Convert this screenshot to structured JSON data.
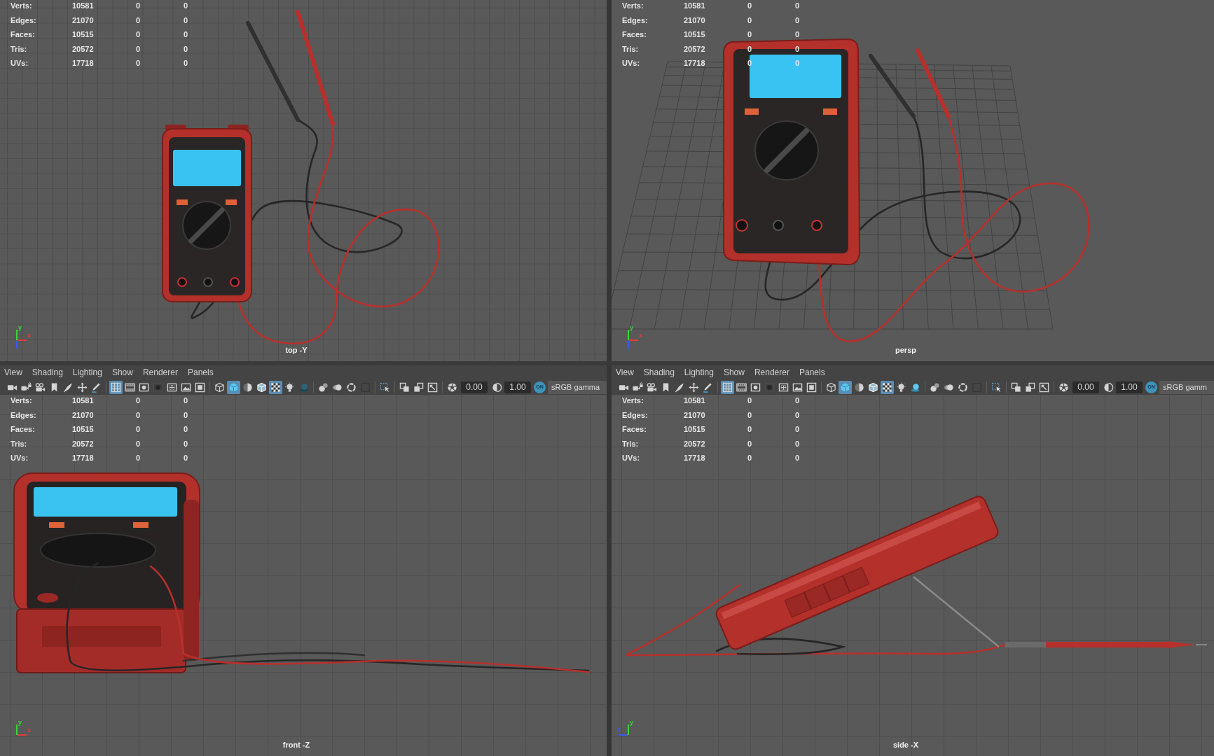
{
  "viewports": [
    {
      "kind": "top",
      "hud": [
        {
          "label": "Verts:",
          "values": [
            "10581",
            "0",
            "0"
          ]
        },
        {
          "label": "Edges:",
          "values": [
            "21070",
            "0",
            "0"
          ]
        },
        {
          "label": "Faces:",
          "values": [
            "10515",
            "0",
            "0"
          ]
        },
        {
          "label": "Tris:",
          "values": [
            "20572",
            "0",
            "0"
          ]
        },
        {
          "label": "UVs:",
          "values": [
            "17718",
            "0",
            "0"
          ]
        }
      ],
      "axes": [
        {
          "label": "y",
          "color": "#3cd43c"
        },
        {
          "label": "x",
          "color": "#e23b3b"
        },
        {
          "color": "#3b5bea"
        }
      ],
      "camera": "top -Y"
    },
    {
      "kind": "persp",
      "hud": [
        {
          "label": "Verts:",
          "values": [
            "10581",
            "0",
            "0"
          ]
        },
        {
          "label": "Edges:",
          "values": [
            "21070",
            "0",
            "0"
          ]
        },
        {
          "label": "Faces:",
          "values": [
            "10515",
            "0",
            "0"
          ]
        },
        {
          "label": "Tris:",
          "values": [
            "20572",
            "0",
            "0"
          ]
        },
        {
          "label": "UVs:",
          "values": [
            "17718",
            "0",
            "0"
          ]
        }
      ],
      "axes": [
        {
          "label": "y",
          "color": "#3cd43c"
        },
        {
          "label": "x",
          "color": "#e23b3b"
        },
        {
          "color": "#3b5bea"
        }
      ],
      "camera": "persp"
    },
    {
      "kind": "front",
      "menu": [
        "View",
        "Shading",
        "Lighting",
        "Show",
        "Renderer",
        "Panels"
      ],
      "toolbar": {
        "groups": [
          {
            "buttons": [
              {
                "on": false,
                "disabled": false
              },
              {
                "on": false,
                "disabled": false
              },
              {
                "on": false,
                "disabled": false
              },
              {
                "on": false,
                "disabled": false
              },
              {
                "on": false,
                "disabled": false
              },
              {
                "on": false,
                "disabled": false
              },
              {
                "on": false,
                "disabled": false
              }
            ]
          },
          {
            "buttons": [
              {
                "on": true,
                "disabled": false
              },
              {
                "on": false,
                "disabled": false
              },
              {
                "on": false,
                "disabled": false
              },
              {
                "on": false,
                "disabled": true
              },
              {
                "on": false,
                "disabled": false
              },
              {
                "on": false,
                "disabled": false
              },
              {
                "on": false,
                "disabled": false
              }
            ]
          },
          {
            "buttons": [
              {
                "on": false,
                "disabled": false
              },
              {
                "on": true,
                "disabled": false
              },
              {
                "on": false,
                "disabled": false
              },
              {
                "on": false,
                "disabled": false
              },
              {
                "on": true,
                "disabled": false
              },
              {
                "on": false,
                "disabled": false
              },
              {
                "on": false,
                "disabled": true
              }
            ]
          },
          {
            "buttons": [
              {
                "on": false,
                "disabled": false
              },
              {
                "on": false,
                "disabled": false
              },
              {
                "on": false,
                "disabled": false
              },
              {
                "on": false,
                "disabled": true
              }
            ]
          },
          {
            "buttons": [
              {
                "on": false,
                "disabled": false
              }
            ]
          },
          {
            "buttons": [
              {
                "on": false,
                "disabled": false
              },
              {
                "on": false,
                "disabled": false
              },
              {
                "on": false,
                "disabled": false
              }
            ]
          }
        ],
        "exposure": "0.00",
        "gamma": "1.00",
        "color_management": {
          "toggle": "ON",
          "label": "sRGB gamma"
        }
      },
      "hud": [
        {
          "label": "Verts:",
          "values": [
            "10581",
            "0",
            "0"
          ]
        },
        {
          "label": "Edges:",
          "values": [
            "21070",
            "0",
            "0"
          ]
        },
        {
          "label": "Faces:",
          "values": [
            "10515",
            "0",
            "0"
          ]
        },
        {
          "label": "Tris:",
          "values": [
            "20572",
            "0",
            "0"
          ]
        },
        {
          "label": "UVs:",
          "values": [
            "17718",
            "0",
            "0"
          ]
        }
      ],
      "axes": [
        {
          "label": "y",
          "color": "#3cd43c"
        },
        {
          "label": "x",
          "color": "#e23b3b"
        }
      ],
      "camera": "front -Z"
    },
    {
      "kind": "side",
      "menu": [
        "View",
        "Shading",
        "Lighting",
        "Show",
        "Renderer",
        "Panels"
      ],
      "toolbar": {
        "groups": [
          {
            "buttons": [
              {
                "on": false,
                "disabled": false
              },
              {
                "on": false,
                "disabled": false
              },
              {
                "on": false,
                "disabled": false
              },
              {
                "on": false,
                "disabled": false
              },
              {
                "on": false,
                "disabled": false
              },
              {
                "on": false,
                "disabled": false
              },
              {
                "on": false,
                "disabled": false
              }
            ]
          },
          {
            "buttons": [
              {
                "on": true,
                "disabled": false
              },
              {
                "on": false,
                "disabled": false
              },
              {
                "on": false,
                "disabled": false
              },
              {
                "on": false,
                "disabled": true
              },
              {
                "on": false,
                "disabled": false
              },
              {
                "on": false,
                "disabled": false
              },
              {
                "on": false,
                "disabled": false
              }
            ]
          },
          {
            "buttons": [
              {
                "on": false,
                "disabled": false
              },
              {
                "on": true,
                "disabled": false
              },
              {
                "on": false,
                "disabled": false
              },
              {
                "on": false,
                "disabled": false
              },
              {
                "on": true,
                "disabled": false
              },
              {
                "on": false,
                "disabled": false
              },
              {
                "on": false,
                "disabled": false
              }
            ]
          },
          {
            "buttons": [
              {
                "on": false,
                "disabled": false
              },
              {
                "on": false,
                "disabled": false
              },
              {
                "on": false,
                "disabled": false
              },
              {
                "on": false,
                "disabled": true
              }
            ]
          },
          {
            "buttons": [
              {
                "on": false,
                "disabled": false
              }
            ]
          },
          {
            "buttons": [
              {
                "on": false,
                "disabled": false
              },
              {
                "on": false,
                "disabled": false
              },
              {
                "on": false,
                "disabled": false
              }
            ]
          }
        ],
        "exposure": "0.00",
        "gamma": "1.00",
        "color_management": {
          "toggle": "ON",
          "label": "sRGB gamm"
        }
      },
      "hud": [
        {
          "label": "Verts:",
          "values": [
            "10581",
            "0",
            "0"
          ]
        },
        {
          "label": "Edges:",
          "values": [
            "21070",
            "0",
            "0"
          ]
        },
        {
          "label": "Faces:",
          "values": [
            "10515",
            "0",
            "0"
          ]
        },
        {
          "label": "Tris:",
          "values": [
            "20572",
            "0",
            "0"
          ]
        },
        {
          "label": "UVs:",
          "values": [
            "17718",
            "0",
            "0"
          ]
        }
      ],
      "axes": [
        {
          "label": "y",
          "color": "#3cd43c"
        },
        {
          "label": "z",
          "color": "#3b5bea"
        }
      ],
      "camera": "side -X"
    }
  ]
}
